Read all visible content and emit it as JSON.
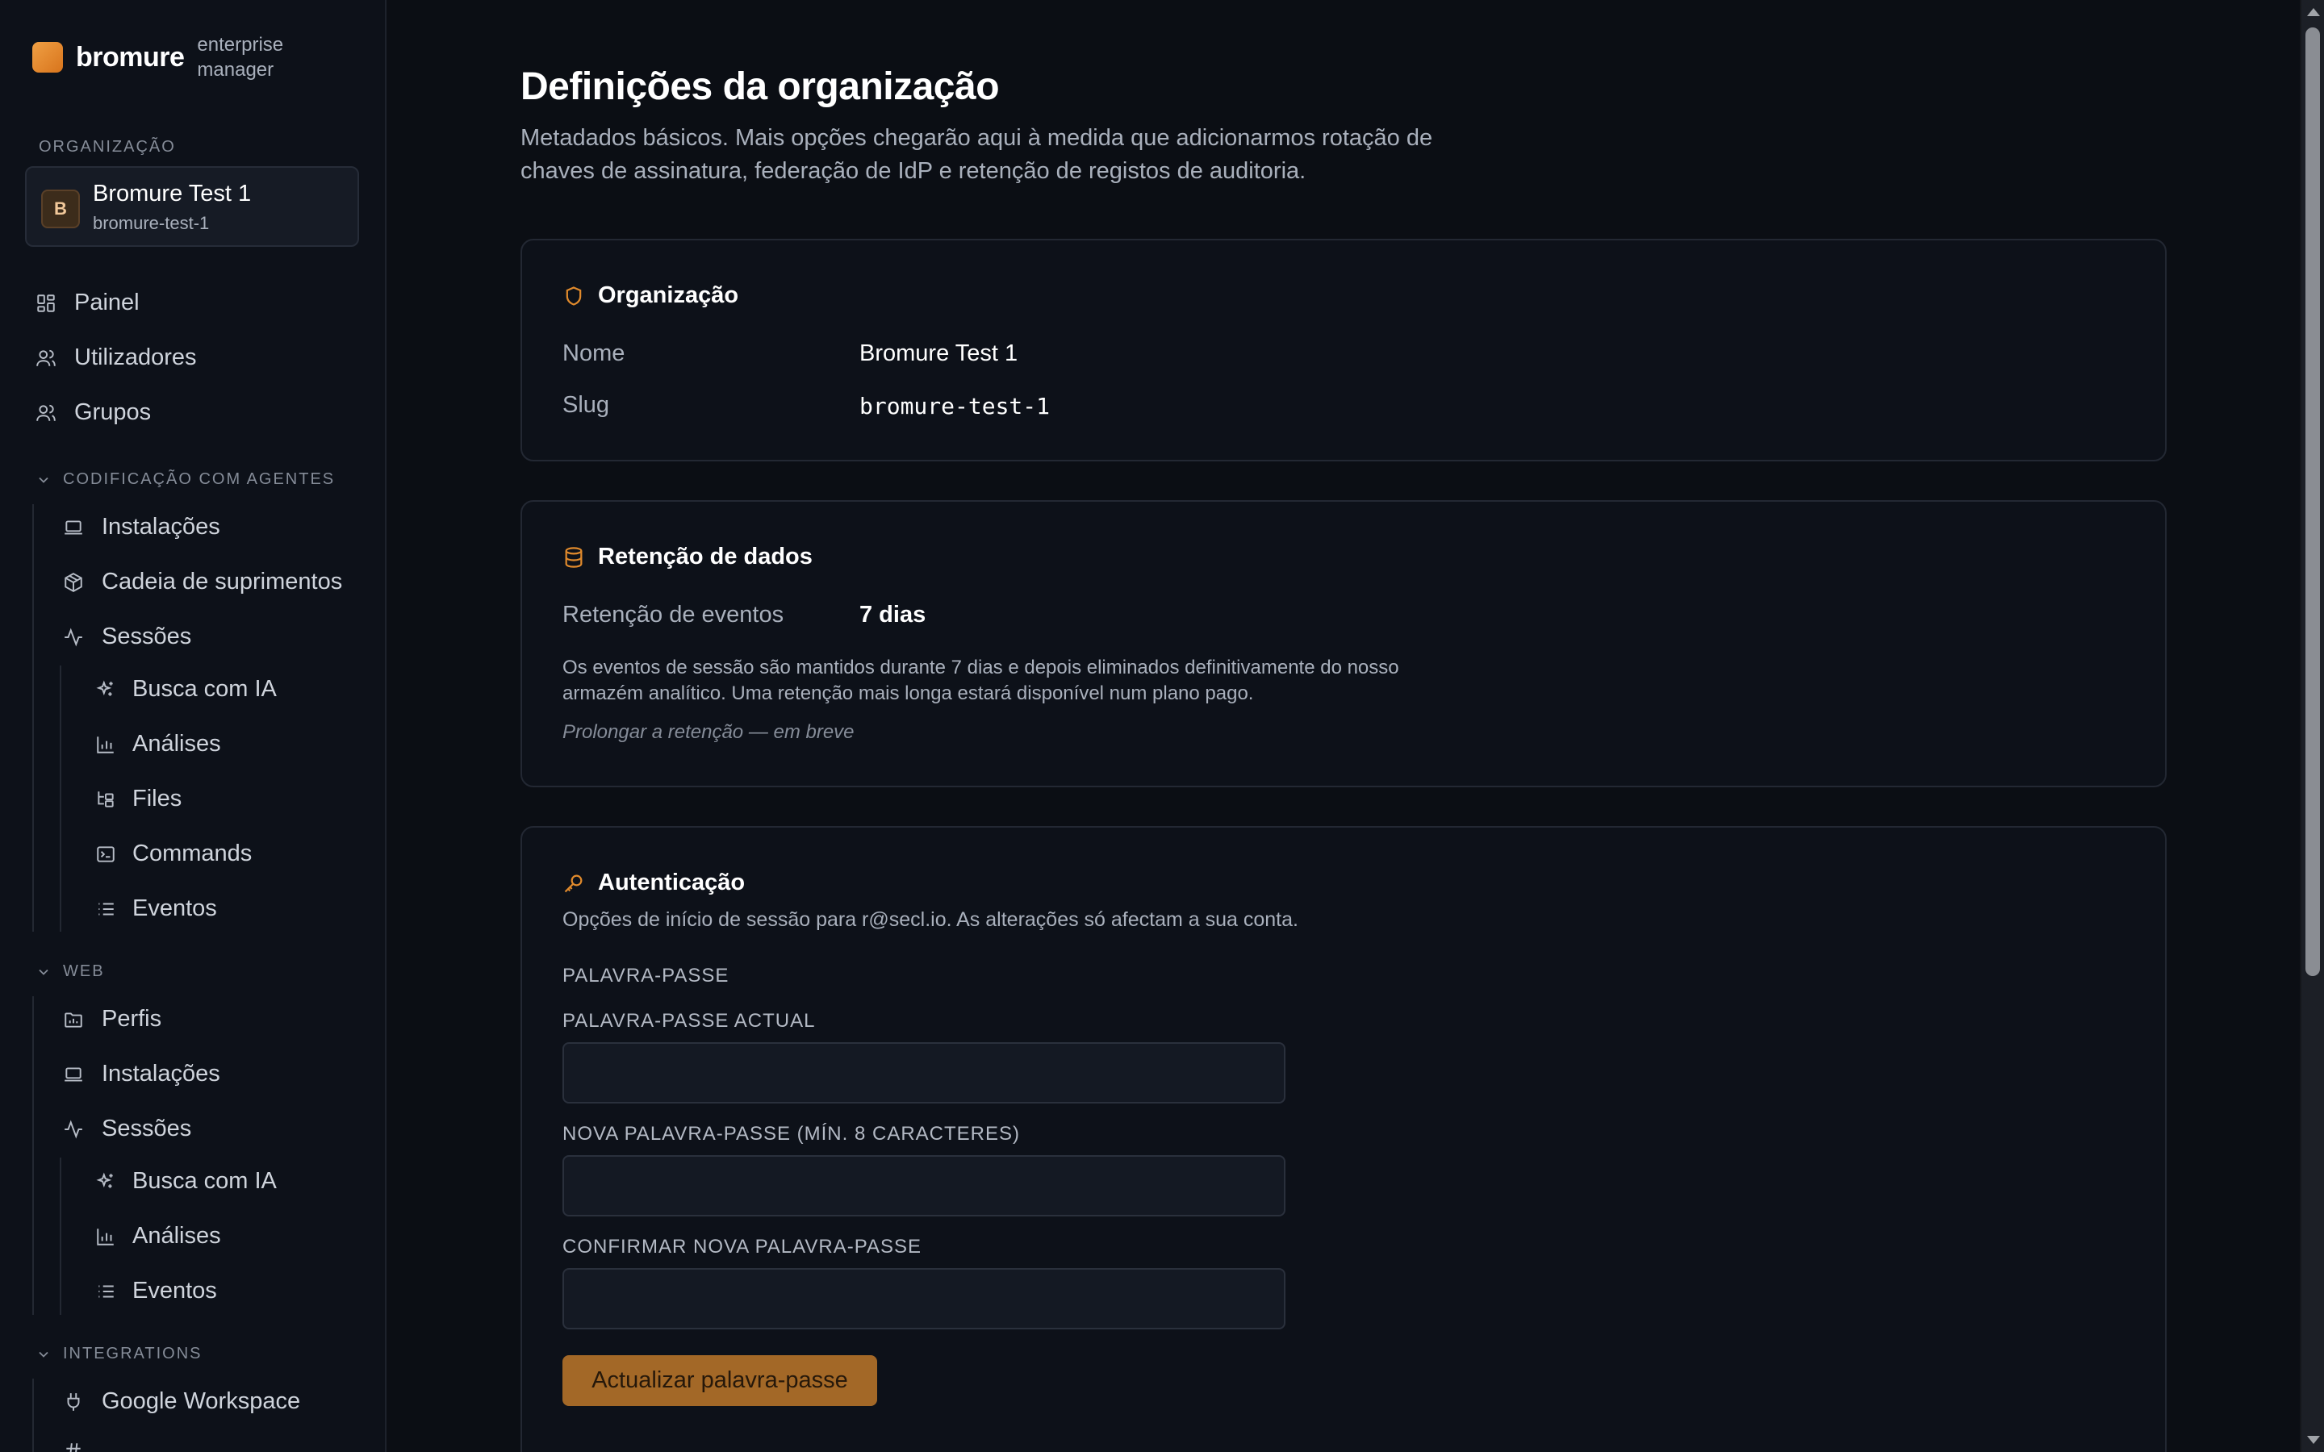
{
  "brand": {
    "name": "bromure",
    "subtitle": "enterprise manager",
    "accent": "#e08a2c"
  },
  "org": {
    "section_label": "ORGANIZAÇÃO",
    "avatar_letter": "B",
    "name": "Bromure Test 1",
    "slug": "bromure-test-1"
  },
  "nav": {
    "top": [
      {
        "label": "Painel",
        "icon": "dashboard-icon"
      },
      {
        "label": "Utilizadores",
        "icon": "users-icon"
      },
      {
        "label": "Grupos",
        "icon": "users-icon"
      }
    ],
    "sections": [
      {
        "label": "CODIFICAÇÃO COM AGENTES",
        "items": [
          {
            "label": "Instalações",
            "icon": "laptop-icon"
          },
          {
            "label": "Cadeia de suprimentos",
            "icon": "package-icon"
          },
          {
            "label": "Sessões",
            "icon": "activity-icon"
          }
        ],
        "subitems": [
          {
            "label": "Busca com IA",
            "icon": "sparkles-icon"
          },
          {
            "label": "Análises",
            "icon": "bar-chart-icon"
          },
          {
            "label": "Files",
            "icon": "folder-tree-icon"
          },
          {
            "label": "Commands",
            "icon": "terminal-icon"
          },
          {
            "label": "Eventos",
            "icon": "list-icon"
          }
        ]
      },
      {
        "label": "WEB",
        "items": [
          {
            "label": "Perfis",
            "icon": "folder-icon"
          },
          {
            "label": "Instalações",
            "icon": "laptop-icon"
          },
          {
            "label": "Sessões",
            "icon": "activity-icon"
          }
        ],
        "subitems": [
          {
            "label": "Busca com IA",
            "icon": "sparkles-icon"
          },
          {
            "label": "Análises",
            "icon": "bar-chart-icon"
          },
          {
            "label": "Eventos",
            "icon": "list-icon"
          }
        ]
      },
      {
        "label": "INTEGRATIONS",
        "items": [
          {
            "label": "Google Workspace",
            "icon": "plug-icon"
          }
        ]
      }
    ]
  },
  "page": {
    "title": "Definições da organização",
    "description": "Metadados básicos. Mais opções chegarão aqui à medida que adicionarmos rotação de chaves de assinatura, federação de IdP e retenção de registos de auditoria."
  },
  "org_card": {
    "title": "Organização",
    "name_key": "Nome",
    "name_value": "Bromure Test 1",
    "slug_key": "Slug",
    "slug_value": "bromure-test-1"
  },
  "retention_card": {
    "title": "Retenção de dados",
    "key": "Retenção de eventos",
    "value": "7 dias",
    "note": "Os eventos de sessão são mantidos durante 7 dias e depois eliminados definitivamente do nosso armazém analítico. Uma retenção mais longa estará disponível num plano pago.",
    "extend": "Prolongar a retenção — em breve"
  },
  "auth_card": {
    "title": "Autenticação",
    "subtitle": "Opções de início de sessão para r@secl.io. As alterações só afectam a sua conta.",
    "group_label": "PALAVRA-PASSE",
    "current_label": "PALAVRA-PASSE ACTUAL",
    "current_value": "",
    "new_label": "NOVA PALAVRA-PASSE (MÍN. 8 CARACTERES)",
    "new_value": "",
    "confirm_label": "CONFIRMAR NOVA PALAVRA-PASSE",
    "confirm_value": "",
    "submit_label": "Actualizar palavra-passe"
  }
}
